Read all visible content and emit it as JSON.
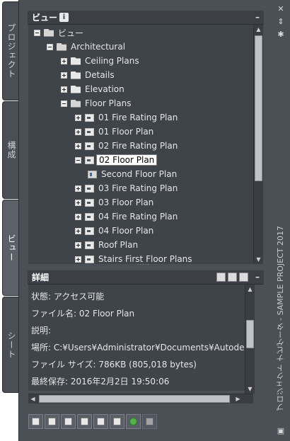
{
  "side_tabs": [
    {
      "label": "プロジェクト"
    },
    {
      "label": "構成"
    },
    {
      "label": "ビュー"
    },
    {
      "label": "シート"
    }
  ],
  "palette_title": "プロジェクト ナビゲータ - SAMPLE PROJECT 2017",
  "views_section": {
    "title": "ビュー",
    "collapse": "–"
  },
  "tree": [
    {
      "label": "ビュー",
      "icon": "folder-open-icon",
      "expander": "minus"
    },
    {
      "label": "Architectural",
      "icon": "folder-open-icon",
      "expander": "minus"
    },
    {
      "label": "Ceiling Plans",
      "icon": "folder-icon",
      "expander": "plus"
    },
    {
      "label": "Details",
      "icon": "folder-icon",
      "expander": "plus"
    },
    {
      "label": "Elevation",
      "icon": "folder-icon",
      "expander": "plus"
    },
    {
      "label": "Floor Plans",
      "icon": "folder-open-icon",
      "expander": "minus"
    },
    {
      "label": "01 Fire Rating Plan",
      "icon": "view-icon",
      "expander": "plus"
    },
    {
      "label": "01 Floor Plan",
      "icon": "view-icon",
      "expander": "plus"
    },
    {
      "label": "02 Fire Rating Plan",
      "icon": "view-icon",
      "expander": "plus"
    },
    {
      "label": "02 Floor Plan",
      "icon": "view-icon",
      "expander": "minus",
      "selected": true
    },
    {
      "label": "Second Floor Plan",
      "icon": "sheet-view-icon",
      "expander": "none"
    },
    {
      "label": "03 Fire Rating Plan",
      "icon": "view-icon",
      "expander": "plus"
    },
    {
      "label": "03 Floor Plan",
      "icon": "view-icon",
      "expander": "plus"
    },
    {
      "label": "04 Fire Rating Plan",
      "icon": "view-icon",
      "expander": "plus"
    },
    {
      "label": "04 Floor Plan",
      "icon": "view-icon",
      "expander": "plus"
    },
    {
      "label": "Roof Plan",
      "icon": "view-icon",
      "expander": "plus"
    },
    {
      "label": "Stairs First Floor Plans",
      "icon": "view-icon",
      "expander": "plus"
    }
  ],
  "details_section": {
    "title": "詳細",
    "collapse": "–",
    "rows": [
      {
        "text": "状態: アクセス可能"
      },
      {
        "text": "ファイル名: 02 Floor Plan"
      },
      {
        "text": "説明:"
      },
      {
        "text": "場所: C:¥Users¥Administrator¥Documents¥Autodesk¥"
      },
      {
        "text": "ファイル サイズ: 786KB (805,018 bytes)"
      },
      {
        "text": "最終保存: 2016年2月2日  19:50:06"
      }
    ]
  },
  "toolbar": [
    {
      "icon": "add-view-icon"
    },
    {
      "icon": "add-detail-view-icon"
    },
    {
      "icon": "add-section-view-icon"
    },
    {
      "icon": "clipboard-icon"
    },
    {
      "icon": "select-cursor-icon"
    },
    {
      "icon": "properties-icon"
    },
    {
      "icon": "refresh-icon"
    },
    {
      "icon": "reconnect-icon"
    }
  ],
  "colors": {
    "panel_bg": "#4b4f56",
    "tree_bg": "#3f434a",
    "header_bg": "#3c4046",
    "text": "#e6e6e6",
    "selection_bg": "#ffffff"
  }
}
